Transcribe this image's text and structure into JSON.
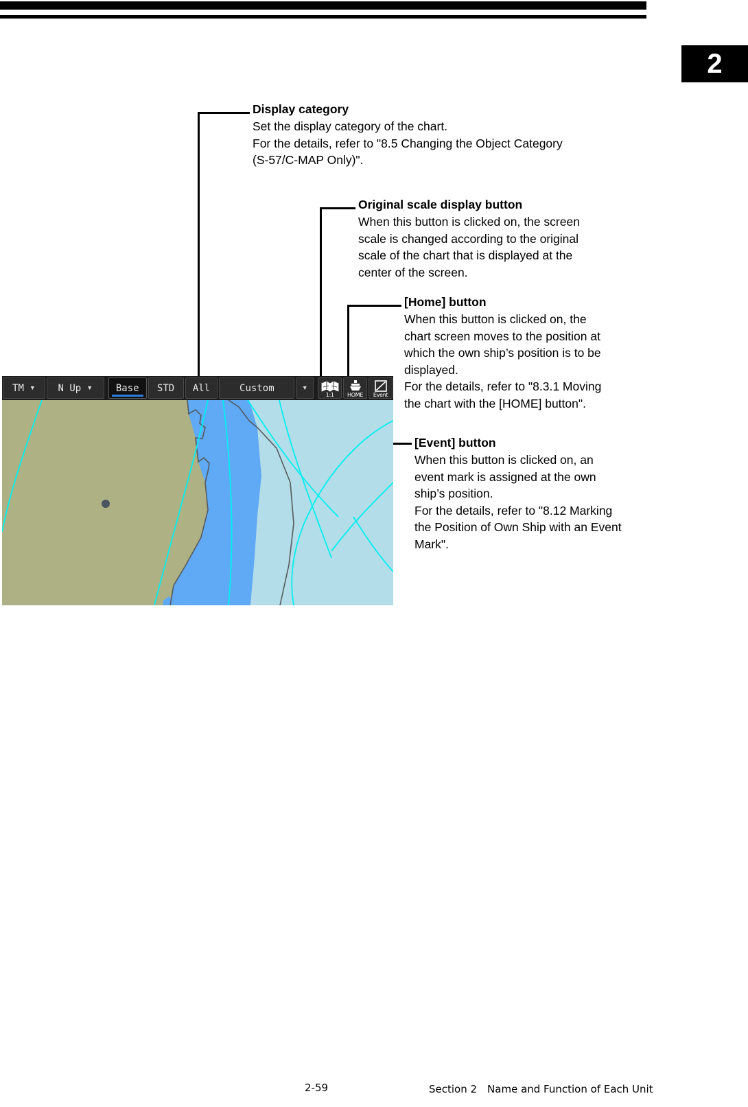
{
  "page": {
    "chapter_tab": "2",
    "footer_page_number": "2-59",
    "footer_section": "Section 2　Name and Function of Each Unit"
  },
  "callouts": [
    {
      "id": "display-category",
      "title": "Display category",
      "lines": [
        "Set the display category of the chart.",
        "For the details, refer to \"8.5 Changing the Object Category",
        "(S-57/C-MAP Only)\"."
      ]
    },
    {
      "id": "original-scale",
      "title": "Original scale display button",
      "lines": [
        "When this button is clicked on, the screen",
        "scale is changed according to the original",
        "scale of the chart that is displayed at the",
        "center of the screen."
      ]
    },
    {
      "id": "home",
      "title": "[Home] button",
      "lines": [
        "When this button is clicked on, the",
        "chart screen moves to the position at",
        "which the own ship’s position is to be",
        "displayed.",
        "For the details, refer to \"8.3.1 Moving",
        "the chart with the [HOME] button\"."
      ]
    },
    {
      "id": "event",
      "title": "[Event] button",
      "lines": [
        "When this button is clicked on, an",
        "event mark is assigned at the own",
        "ship’s position.",
        "For the details, refer to \"8.12 Marking",
        "the Position of Own Ship with an Event",
        "Mark\"."
      ]
    }
  ],
  "ecdis": {
    "toolbar": {
      "motion_mode": {
        "label": "TM",
        "caret": "▼"
      },
      "orientation": {
        "label": "N Up",
        "caret": "▼"
      },
      "category_base": "Base",
      "category_std": "STD",
      "category_all": "All",
      "category_custom": "Custom",
      "category_custom_caret": "▼",
      "selected_category": "Base",
      "original_scale_icon": "chart-scale-icon",
      "original_scale_label": "1:1",
      "home_icon": "own-ship-icon",
      "home_label": "HOME",
      "event_icon": "event-mark-icon",
      "event_label": "Event"
    },
    "chart_colors": {
      "land": "#adb183",
      "shallow_water": "#5fa9f5",
      "deep_water": "#b3dde8",
      "contour_line": "#00f0f0",
      "coastline": "#555555",
      "toolbar_bg": "#1b1b1b",
      "accent_blue": "#2f7fe0"
    },
    "chart_features": {
      "own_ship_dot": "own-ship-position-dot",
      "depth_contours": "cyan latitude/longitude and depth contour lines"
    }
  }
}
